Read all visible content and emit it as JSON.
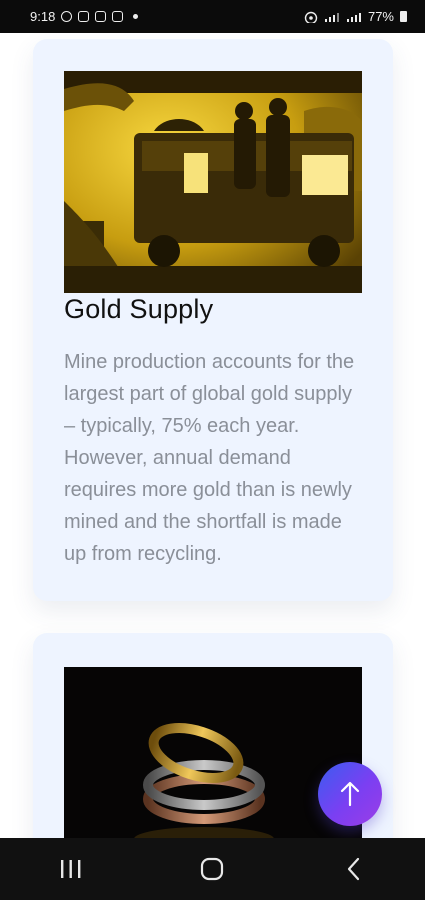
{
  "status_bar": {
    "time": "9:18",
    "battery": "77%",
    "icons": [
      "whatsapp-icon",
      "gmail-icon",
      "instagram-icon",
      "gallery-icon",
      "notification-dot",
      "hotspot-icon",
      "wifi-signal-icon",
      "cell-signal-icon",
      "battery-icon"
    ]
  },
  "cards": [
    {
      "title": "Gold Supply",
      "text": "Mine production accounts for the largest part of global gold supply – typically, 75% each year. However, annual demand requires more gold than is newly mined and the shortfall is made up from recycling.",
      "image": "gold mine cart with miners"
    },
    {
      "image": "stacked gold and silver rings"
    }
  ],
  "fab": {
    "icon": "arrow-up-icon",
    "colors": [
      "#3a5df0",
      "#9b3de6"
    ]
  },
  "nav_bar": {
    "icons": [
      "recent-apps-icon",
      "home-icon",
      "back-icon"
    ]
  }
}
